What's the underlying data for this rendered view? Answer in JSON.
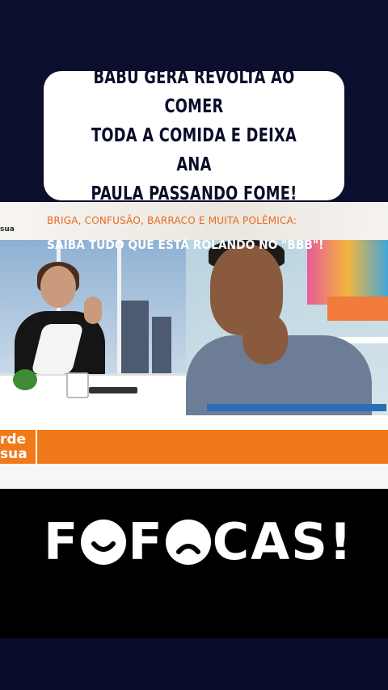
{
  "headline": {
    "line1": "BABU GERA REVOLTA AO COMER",
    "line2": "TODA A COMIDA E DEIXA ANA",
    "line3": "PAULA PASSANDO FOME!"
  },
  "tv": {
    "channel_tag": "sua",
    "show_logo_line1": "rde",
    "show_logo_line2": "sua",
    "ticker_top": "BRIGA, CONFUSÃO, BARRACO E MUITA POLÊMICA:",
    "ticker_main": "SAIBA TUDO QUE ESTÁ ROLANDO NO \"BBB\"!"
  },
  "brand": {
    "letters_a": "F",
    "letters_b": "F",
    "letters_c": "CAS!"
  },
  "colors": {
    "background": "#0a0d2a",
    "ticker_orange": "#f07a1a",
    "card": "#ffffff"
  }
}
